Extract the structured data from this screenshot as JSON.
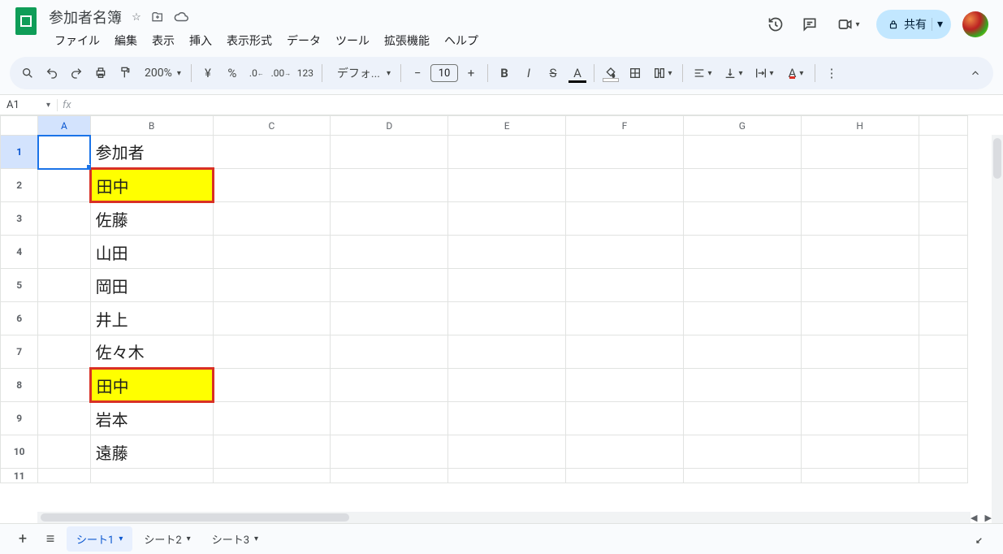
{
  "doc_title": "参加者名簿",
  "menus": [
    "ファイル",
    "編集",
    "表示",
    "挿入",
    "表示形式",
    "データ",
    "ツール",
    "拡張機能",
    "ヘルプ"
  ],
  "share_label": "共有",
  "toolbar": {
    "zoom": "200%",
    "font": "デフォ...",
    "font_size": "10"
  },
  "namebox": "A1",
  "formula_value": "",
  "columns": [
    "A",
    "B",
    "C",
    "D",
    "E",
    "F",
    "G",
    "H"
  ],
  "rows": [
    {
      "n": "1",
      "b": "参加者",
      "hl": false
    },
    {
      "n": "2",
      "b": "田中",
      "hl": true
    },
    {
      "n": "3",
      "b": "佐藤",
      "hl": false
    },
    {
      "n": "4",
      "b": "山田",
      "hl": false
    },
    {
      "n": "5",
      "b": "岡田",
      "hl": false
    },
    {
      "n": "6",
      "b": "井上",
      "hl": false
    },
    {
      "n": "7",
      "b": "佐々木",
      "hl": false
    },
    {
      "n": "8",
      "b": "田中",
      "hl": true
    },
    {
      "n": "9",
      "b": "岩本",
      "hl": false
    },
    {
      "n": "10",
      "b": "遠藤",
      "hl": false
    },
    {
      "n": "11",
      "b": "",
      "hl": false
    }
  ],
  "active_cell": "A1",
  "sheets": [
    {
      "name": "シート1",
      "active": true
    },
    {
      "name": "シート2",
      "active": false
    },
    {
      "name": "シート3",
      "active": false
    }
  ]
}
